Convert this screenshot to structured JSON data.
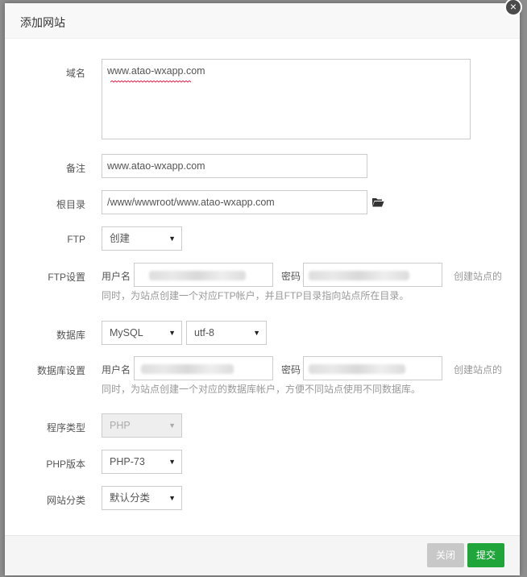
{
  "dialog": {
    "title": "添加网站",
    "close_icon": "close-icon"
  },
  "form": {
    "domain": {
      "label": "域名",
      "value": "www.atao-wxapp.com"
    },
    "remark": {
      "label": "备注",
      "value": "www.atao-wxapp.com"
    },
    "root": {
      "label": "根目录",
      "value": "/www/wwwroot/www.atao-wxapp.com",
      "icon": "folder-open-icon"
    },
    "ftp": {
      "label": "FTP",
      "value": "创建"
    },
    "ftp_settings": {
      "label": "FTP设置",
      "user_label": "用户名",
      "pass_label": "密码",
      "hint_line1": "创建站点的",
      "hint_line2": "同时，为站点创建一个对应FTP帐户，并且FTP目录指向站点所在目录。"
    },
    "database": {
      "label": "数据库",
      "type_value": "MySQL",
      "charset_value": "utf-8"
    },
    "db_settings": {
      "label": "数据库设置",
      "user_label": "用户名",
      "pass_label": "密码",
      "hint_line1": "创建站点的",
      "hint_line2": "同时，为站点创建一个对应的数据库帐户，方便不同站点使用不同数据库。"
    },
    "program_type": {
      "label": "程序类型",
      "value": "PHP"
    },
    "php_version": {
      "label": "PHP版本",
      "value": "PHP-73"
    },
    "site_category": {
      "label": "网站分类",
      "value": "默认分类"
    }
  },
  "footer": {
    "close_label": "关闭",
    "submit_label": "提交"
  },
  "colors": {
    "submit": "#20a53a",
    "close_disabled": "#c8c8c8"
  }
}
